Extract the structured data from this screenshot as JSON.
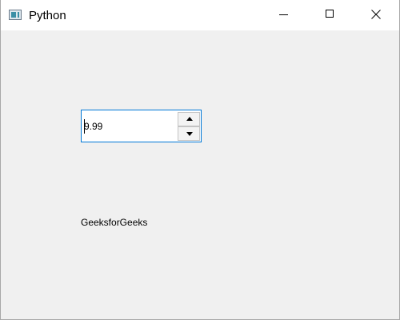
{
  "window": {
    "title": "Python",
    "icon": "python-app-icon",
    "controls": [
      "minimize-icon",
      "maximize-icon",
      "close-icon"
    ]
  },
  "spinbox": {
    "value": "9.99",
    "up_icon": "arrow-up-icon",
    "down_icon": "arrow-down-icon",
    "focus_border_color": "#0078d7"
  },
  "label": {
    "text": "GeeksforGeeks"
  },
  "colors": {
    "background": "#f0f0f0",
    "titlebar": "#ffffff"
  }
}
